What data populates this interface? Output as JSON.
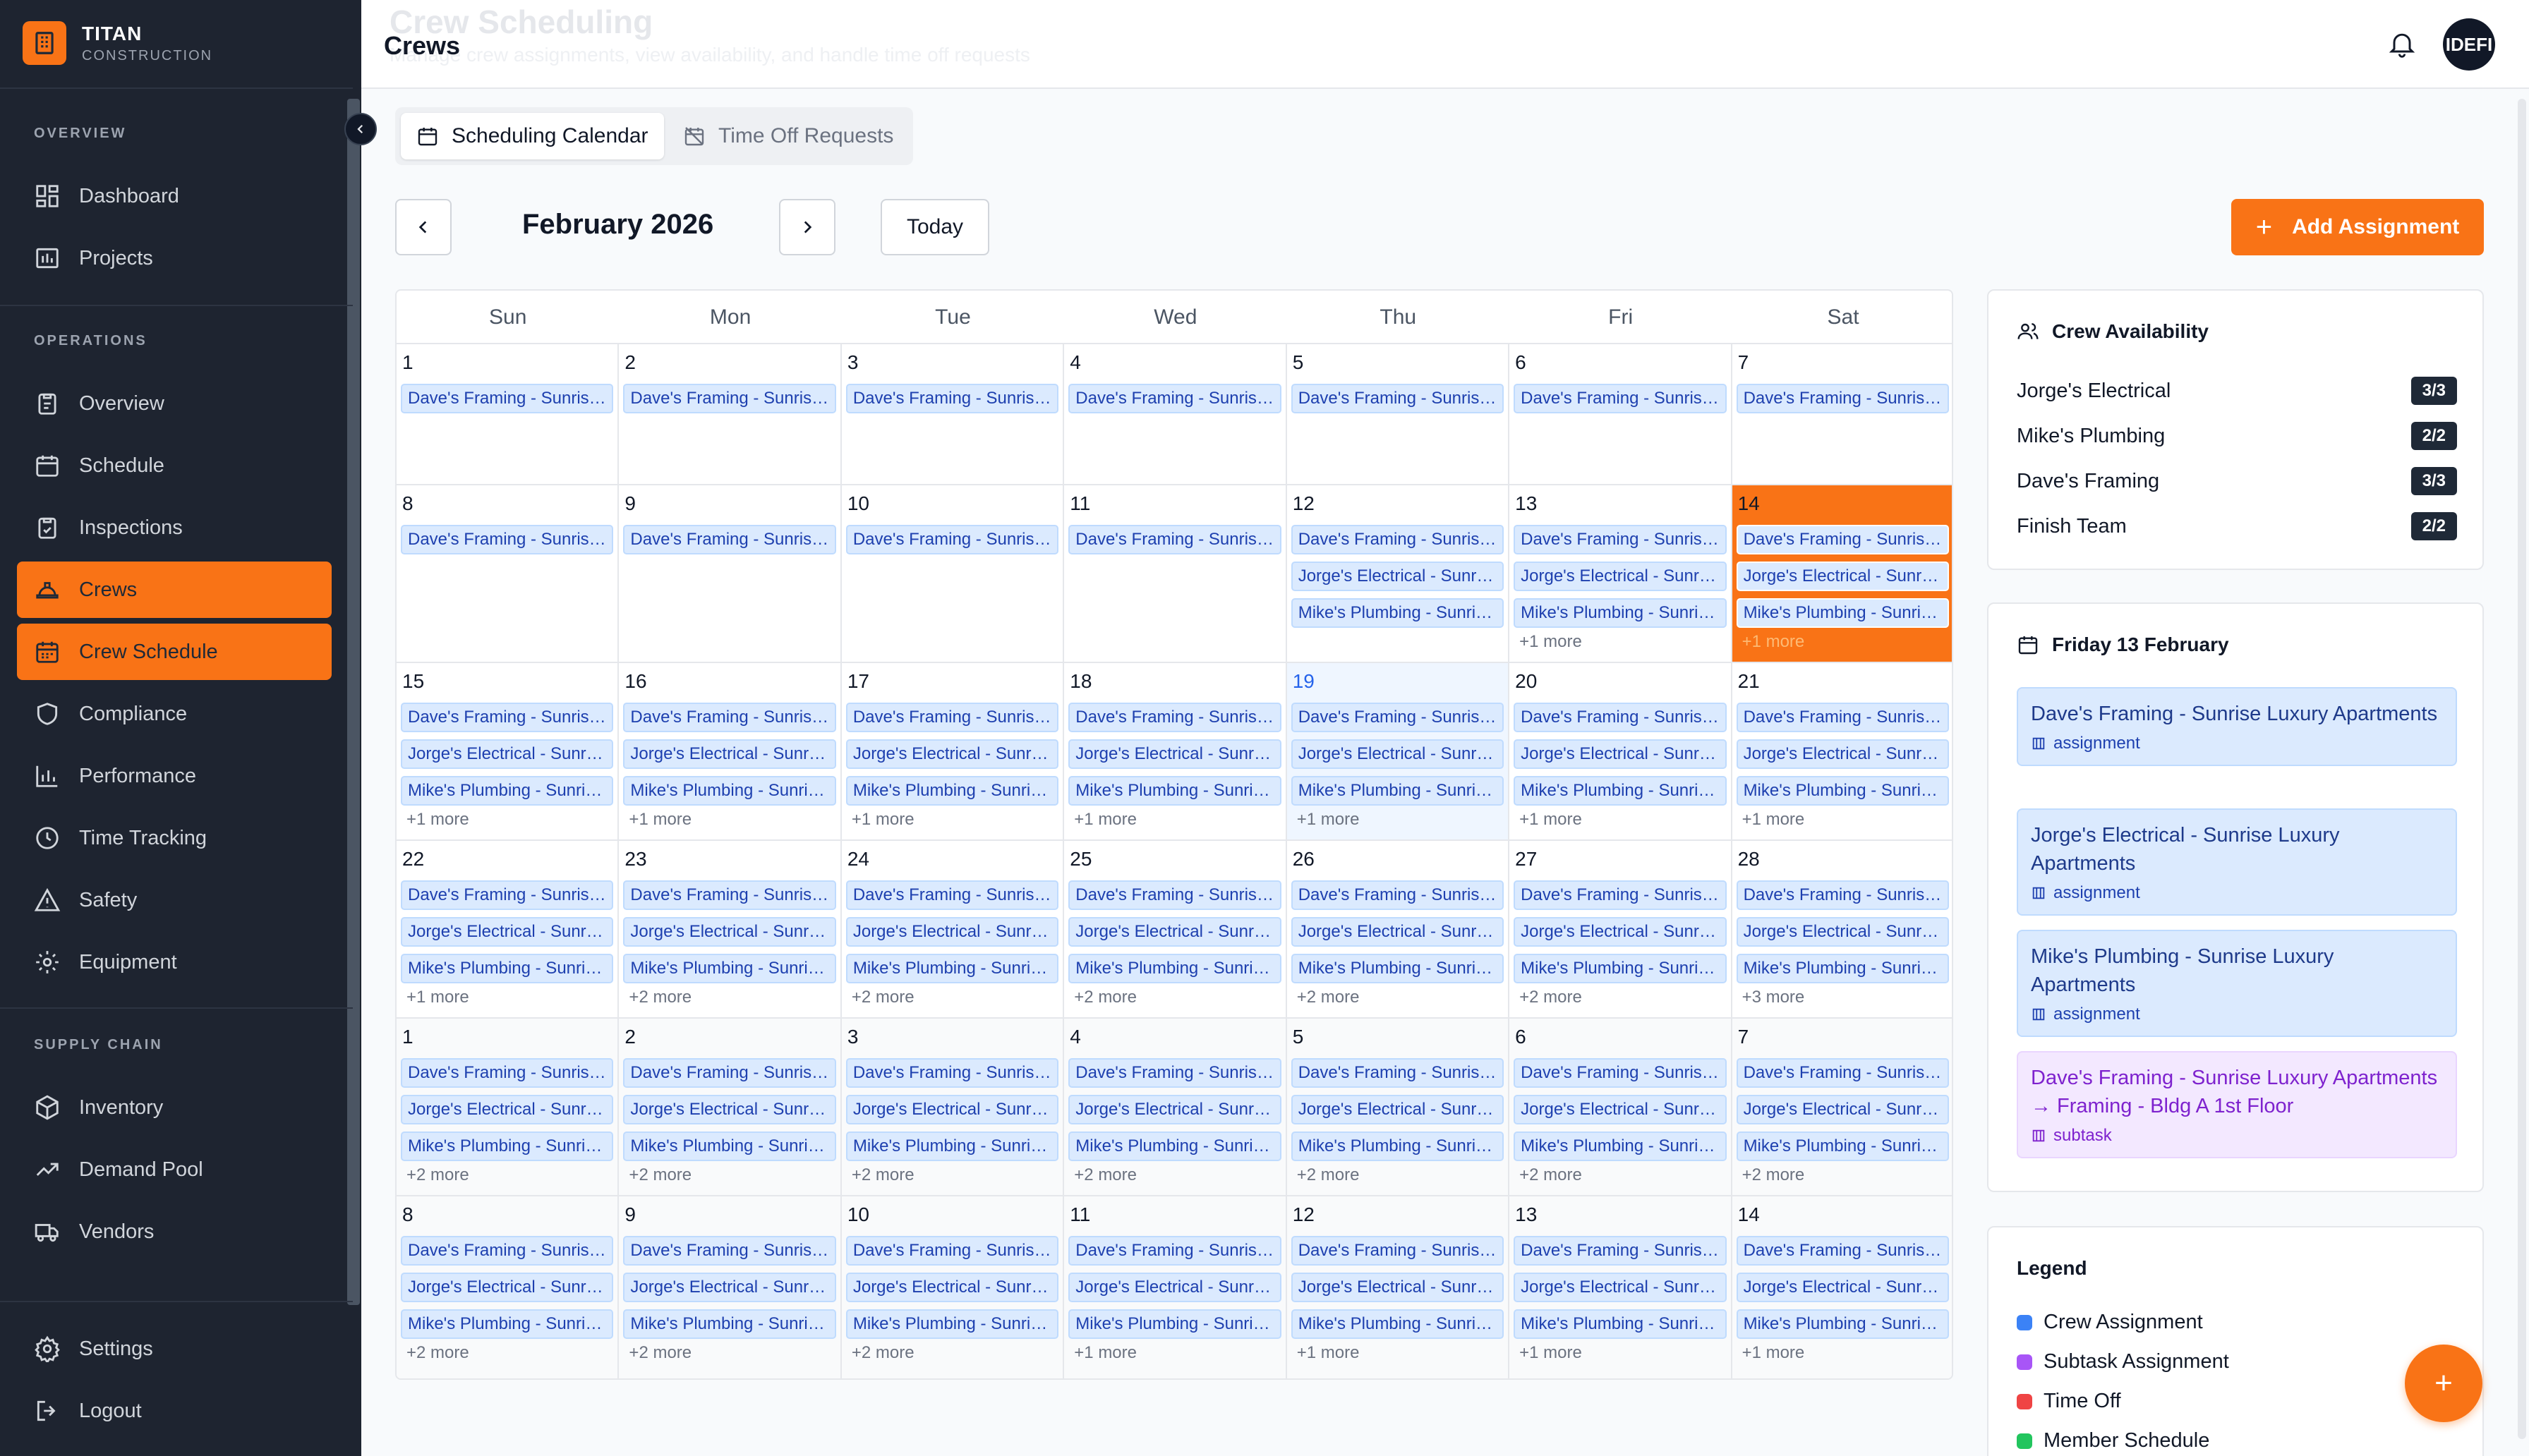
{
  "brand": {
    "name": "TITAN",
    "sub": "CONSTRUCTION"
  },
  "sidebar": {
    "sections": [
      "OVERVIEW",
      "OPERATIONS",
      "SUPPLY CHAIN"
    ],
    "items": [
      {
        "label": "Dashboard",
        "icon": "dashboard-icon"
      },
      {
        "label": "Projects",
        "icon": "projects-icon"
      },
      {
        "label": "Overview",
        "icon": "clipboard-icon"
      },
      {
        "label": "Schedule",
        "icon": "calendar-icon"
      },
      {
        "label": "Inspections",
        "icon": "check-clipboard-icon"
      },
      {
        "label": "Crews",
        "icon": "hardhat-icon"
      },
      {
        "label": "Crew Schedule",
        "icon": "calendar-grid-icon"
      },
      {
        "label": "Compliance",
        "icon": "shield-icon"
      },
      {
        "label": "Performance",
        "icon": "bar-chart-icon"
      },
      {
        "label": "Time Tracking",
        "icon": "clock-icon"
      },
      {
        "label": "Safety",
        "icon": "warning-icon"
      },
      {
        "label": "Equipment",
        "icon": "gear-icon"
      },
      {
        "label": "Inventory",
        "icon": "box-icon"
      },
      {
        "label": "Demand Pool",
        "icon": "trend-icon"
      },
      {
        "label": "Vendors",
        "icon": "truck-icon"
      },
      {
        "label": "Settings",
        "icon": "settings-icon"
      },
      {
        "label": "Logout",
        "icon": "logout-icon"
      }
    ]
  },
  "header": {
    "title": "Crews",
    "ghost_title": "Crew Scheduling",
    "ghost_sub": "Manage crew assignments, view availability, and handle time off requests",
    "avatar": "IDEFI"
  },
  "tabs": [
    "Scheduling Calendar",
    "Time Off Requests"
  ],
  "toolbar": {
    "month": "February 2026",
    "today": "Today",
    "add": "Add Assignment"
  },
  "calendar": {
    "dow": [
      "Sun",
      "Mon",
      "Tue",
      "Wed",
      "Thu",
      "Fri",
      "Sat"
    ],
    "weeks": [
      [
        {
          "d": "1",
          "e": [
            "Dave's Framing - Sunrise Luxury Apartments"
          ],
          "m": ""
        },
        {
          "d": "2",
          "e": [
            "Dave's Framing - Sunrise Luxury Apartments"
          ],
          "m": ""
        },
        {
          "d": "3",
          "e": [
            "Dave's Framing - Sunrise Luxury Apartments"
          ],
          "m": ""
        },
        {
          "d": "4",
          "e": [
            "Dave's Framing - Sunrise Luxury Apartments"
          ],
          "m": ""
        },
        {
          "d": "5",
          "e": [
            "Dave's Framing - Sunrise Luxury Apartments"
          ],
          "m": ""
        },
        {
          "d": "6",
          "e": [
            "Dave's Framing - Sunrise Luxury Apartments"
          ],
          "m": ""
        },
        {
          "d": "7",
          "e": [
            "Dave's Framing - Sunrise Luxury Apartments"
          ],
          "m": ""
        }
      ],
      [
        {
          "d": "8",
          "e": [
            "Dave's Framing - Sunrise Luxury Apartments"
          ],
          "m": ""
        },
        {
          "d": "9",
          "e": [
            "Dave's Framing - Sunrise Luxury Apartments"
          ],
          "m": ""
        },
        {
          "d": "10",
          "e": [
            "Dave's Framing - Sunrise Luxury Apartments"
          ],
          "m": ""
        },
        {
          "d": "11",
          "e": [
            "Dave's Framing - Sunrise Luxury Apartments"
          ],
          "m": ""
        },
        {
          "d": "12",
          "e": [
            "Dave's Framing - Sunrise Luxury Apartments",
            "Jorge's Electrical - Sunrise Luxury Apartments",
            "Mike's Plumbing - Sunrise Luxury Apartments"
          ],
          "m": ""
        },
        {
          "d": "13",
          "e": [
            "Dave's Framing - Sunrise Luxury Apartments",
            "Jorge's Electrical - Sunrise Luxury Apartments",
            "Mike's Plumbing - Sunrise Luxury Apartments"
          ],
          "m": "+1 more"
        },
        {
          "d": "14",
          "e": [
            "Dave's Framing - Sunrise Luxury Apartments",
            "Jorge's Electrical - Sunrise Luxury Apartments",
            "Mike's Plumbing - Sunrise Luxury Apartments"
          ],
          "m": "+1 more",
          "selected": true
        }
      ],
      [
        {
          "d": "15",
          "e": [
            "Dave's Framing - Sunrise Luxury Apartments",
            "Jorge's Electrical - Sunrise Luxury Apartments",
            "Mike's Plumbing - Sunrise Luxury Apartments"
          ],
          "m": "+1 more"
        },
        {
          "d": "16",
          "e": [
            "Dave's Framing - Sunrise Luxury Apartments",
            "Jorge's Electrical - Sunrise Luxury Apartments",
            "Mike's Plumbing - Sunrise Luxury Apartments"
          ],
          "m": "+1 more"
        },
        {
          "d": "17",
          "e": [
            "Dave's Framing - Sunrise Luxury Apartments",
            "Jorge's Electrical - Sunrise Luxury Apartments",
            "Mike's Plumbing - Sunrise Luxury Apartments"
          ],
          "m": "+1 more"
        },
        {
          "d": "18",
          "e": [
            "Dave's Framing - Sunrise Luxury Apartments",
            "Jorge's Electrical - Sunrise Luxury Apartments",
            "Mike's Plumbing - Sunrise Luxury Apartments"
          ],
          "m": "+1 more"
        },
        {
          "d": "19",
          "e": [
            "Dave's Framing - Sunrise Luxury Apartments",
            "Jorge's Electrical - Sunrise Luxury Apartments",
            "Mike's Plumbing - Sunrise Luxury Apartments"
          ],
          "m": "+1 more",
          "today": true
        },
        {
          "d": "20",
          "e": [
            "Dave's Framing - Sunrise Luxury Apartments",
            "Jorge's Electrical - Sunrise Luxury Apartments",
            "Mike's Plumbing - Sunrise Luxury Apartments"
          ],
          "m": "+1 more"
        },
        {
          "d": "21",
          "e": [
            "Dave's Framing - Sunrise Luxury Apartments",
            "Jorge's Electrical - Sunrise Luxury Apartments",
            "Mike's Plumbing - Sunrise Luxury Apartments"
          ],
          "m": "+1 more"
        }
      ],
      [
        {
          "d": "22",
          "e": [
            "Dave's Framing - Sunrise Luxury Apartments",
            "Jorge's Electrical - Sunrise Luxury Apartments",
            "Mike's Plumbing - Sunrise Luxury Apartments"
          ],
          "m": "+1 more"
        },
        {
          "d": "23",
          "e": [
            "Dave's Framing - Sunrise Luxury Apartments",
            "Jorge's Electrical - Sunrise Luxury Apartments",
            "Mike's Plumbing - Sunrise Luxury Apartments"
          ],
          "m": "+2 more"
        },
        {
          "d": "24",
          "e": [
            "Dave's Framing - Sunrise Luxury Apartments",
            "Jorge's Electrical - Sunrise Luxury Apartments",
            "Mike's Plumbing - Sunrise Luxury Apartments"
          ],
          "m": "+2 more"
        },
        {
          "d": "25",
          "e": [
            "Dave's Framing - Sunrise Luxury Apartments",
            "Jorge's Electrical - Sunrise Luxury Apartments",
            "Mike's Plumbing - Sunrise Luxury Apartments"
          ],
          "m": "+2 more"
        },
        {
          "d": "26",
          "e": [
            "Dave's Framing - Sunrise Luxury Apartments",
            "Jorge's Electrical - Sunrise Luxury Apartments",
            "Mike's Plumbing - Sunrise Luxury Apartments"
          ],
          "m": "+2 more"
        },
        {
          "d": "27",
          "e": [
            "Dave's Framing - Sunrise Luxury Apartments",
            "Jorge's Electrical - Sunrise Luxury Apartments",
            "Mike's Plumbing - Sunrise Luxury Apartments"
          ],
          "m": "+2 more"
        },
        {
          "d": "28",
          "e": [
            "Dave's Framing - Sunrise Luxury Apartments",
            "Jorge's Electrical - Sunrise Luxury Apartments",
            "Mike's Plumbing - Sunrise Luxury Apartments"
          ],
          "m": "+3 more"
        }
      ],
      [
        {
          "d": "1",
          "e": [
            "Dave's Framing - Sunrise Luxury Apartments",
            "Jorge's Electrical - Sunrise Luxury Apartments",
            "Mike's Plumbing - Sunrise Luxury Apartments"
          ],
          "m": "+2 more",
          "other": true
        },
        {
          "d": "2",
          "e": [
            "Dave's Framing - Sunrise Luxury Apartments",
            "Jorge's Electrical - Sunrise Luxury Apartments",
            "Mike's Plumbing - Sunrise Luxury Apartments"
          ],
          "m": "+2 more",
          "other": true
        },
        {
          "d": "3",
          "e": [
            "Dave's Framing - Sunrise Luxury Apartments",
            "Jorge's Electrical - Sunrise Luxury Apartments",
            "Mike's Plumbing - Sunrise Luxury Apartments"
          ],
          "m": "+2 more",
          "other": true
        },
        {
          "d": "4",
          "e": [
            "Dave's Framing - Sunrise Luxury Apartments",
            "Jorge's Electrical - Sunrise Luxury Apartments",
            "Mike's Plumbing - Sunrise Luxury Apartments"
          ],
          "m": "+2 more",
          "other": true
        },
        {
          "d": "5",
          "e": [
            "Dave's Framing - Sunrise Luxury Apartments",
            "Jorge's Electrical - Sunrise Luxury Apartments",
            "Mike's Plumbing - Sunrise Luxury Apartments"
          ],
          "m": "+2 more",
          "other": true
        },
        {
          "d": "6",
          "e": [
            "Dave's Framing - Sunrise Luxury Apartments",
            "Jorge's Electrical - Sunrise Luxury Apartments",
            "Mike's Plumbing - Sunrise Luxury Apartments"
          ],
          "m": "+2 more",
          "other": true
        },
        {
          "d": "7",
          "e": [
            "Dave's Framing - Sunrise Luxury Apartments",
            "Jorge's Electrical - Sunrise Luxury Apartments",
            "Mike's Plumbing - Sunrise Luxury Apartments"
          ],
          "m": "+2 more",
          "other": true
        }
      ],
      [
        {
          "d": "8",
          "e": [
            "Dave's Framing - Sunrise Luxury Apartments",
            "Jorge's Electrical - Sunrise Luxury Apartments",
            "Mike's Plumbing - Sunrise Luxury Apartments"
          ],
          "m": "+2 more",
          "other": true
        },
        {
          "d": "9",
          "e": [
            "Dave's Framing - Sunrise Luxury Apartments",
            "Jorge's Electrical - Sunrise Luxury Apartments",
            "Mike's Plumbing - Sunrise Luxury Apartments"
          ],
          "m": "+2 more",
          "other": true
        },
        {
          "d": "10",
          "e": [
            "Dave's Framing - Sunrise Luxury Apartments",
            "Jorge's Electrical - Sunrise Luxury Apartments",
            "Mike's Plumbing - Sunrise Luxury Apartments"
          ],
          "m": "+2 more",
          "other": true
        },
        {
          "d": "11",
          "e": [
            "Dave's Framing - Sunrise Luxury Apartments",
            "Jorge's Electrical - Sunrise Luxury Apartments",
            "Mike's Plumbing - Sunrise Luxury Apartments"
          ],
          "m": "+1 more",
          "other": true
        },
        {
          "d": "12",
          "e": [
            "Dave's Framing - Sunrise Luxury Apartments",
            "Jorge's Electrical - Sunrise Luxury Apartments",
            "Mike's Plumbing - Sunrise Luxury Apartments"
          ],
          "m": "+1 more",
          "other": true
        },
        {
          "d": "13",
          "e": [
            "Dave's Framing - Sunrise Luxury Apartments",
            "Jorge's Electrical - Sunrise Luxury Apartments",
            "Mike's Plumbing - Sunrise Luxury Apartments"
          ],
          "m": "+1 more",
          "other": true
        },
        {
          "d": "14",
          "e": [
            "Dave's Framing - Sunrise Luxury Apartments",
            "Jorge's Electrical - Sunrise Luxury Apartments",
            "Mike's Plumbing - Sunrise Luxury Apartments"
          ],
          "m": "+1 more",
          "other": true
        }
      ]
    ]
  },
  "availability": {
    "title": "Crew Availability",
    "rows": [
      {
        "name": "Jorge's Electrical",
        "count": "3/3"
      },
      {
        "name": "Mike's Plumbing",
        "count": "2/2"
      },
      {
        "name": "Dave's Framing",
        "count": "3/3"
      },
      {
        "name": "Finish Team",
        "count": "2/2"
      }
    ]
  },
  "day_detail": {
    "title": "Friday 13 February",
    "cards": [
      {
        "text": "Dave's Framing - Sunrise Luxury Apartments",
        "kind": "assignment",
        "color": "blue"
      },
      {
        "text": "Jorge's Electrical - Sunrise Luxury Apartments",
        "kind": "assignment",
        "color": "blue"
      },
      {
        "text": "Mike's Plumbing - Sunrise Luxury Apartments",
        "kind": "assignment",
        "color": "blue"
      },
      {
        "text": "Dave's Framing - Sunrise Luxury Apartments → Framing - Bldg A 1st Floor",
        "kind": "subtask",
        "color": "purple"
      }
    ]
  },
  "legend": {
    "title": "Legend",
    "items": [
      {
        "label": "Crew Assignment",
        "color": "#3b82f6"
      },
      {
        "label": "Subtask Assignment",
        "color": "#a855f7"
      },
      {
        "label": "Time Off",
        "color": "#ef4444"
      },
      {
        "label": "Member Schedule",
        "color": "#22c55e"
      }
    ]
  },
  "fab": "+"
}
